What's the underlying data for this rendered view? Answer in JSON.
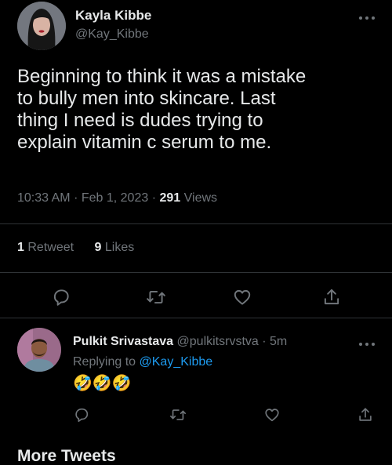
{
  "tweet": {
    "author_name": "Kayla Kibbe",
    "author_handle": "@Kay_Kibbe",
    "text": "Beginning to think it was a mistake\nto bully men into skincare. Last\nthing I need is dudes trying to\nexplain vitamin c serum to me.",
    "time": "10:33 AM",
    "date": "Feb 1, 2023",
    "views_count": "291",
    "views_label": "Views",
    "retweets_count": "1",
    "retweets_label": "Retweet",
    "likes_count": "9",
    "likes_label": "Likes"
  },
  "reply": {
    "author_name": "Pulkit Srivastava",
    "author_handle": "@pulkitsrvstva",
    "time_ago": "5m",
    "replying_to_label": "Replying to",
    "replying_to_handle": "@Kay_Kibbe",
    "text": "🤣🤣🤣"
  },
  "section": {
    "more_tweets": "More Tweets"
  },
  "icons": {
    "more": "more-horizontal-icon",
    "reply": "reply-icon",
    "retweet": "retweet-icon",
    "like": "heart-icon",
    "share": "share-icon"
  },
  "colors": {
    "background": "#000000",
    "text_primary": "#e7e9ea",
    "text_secondary": "#71767b",
    "link": "#1d9bf0",
    "divider": "#2f3336"
  }
}
